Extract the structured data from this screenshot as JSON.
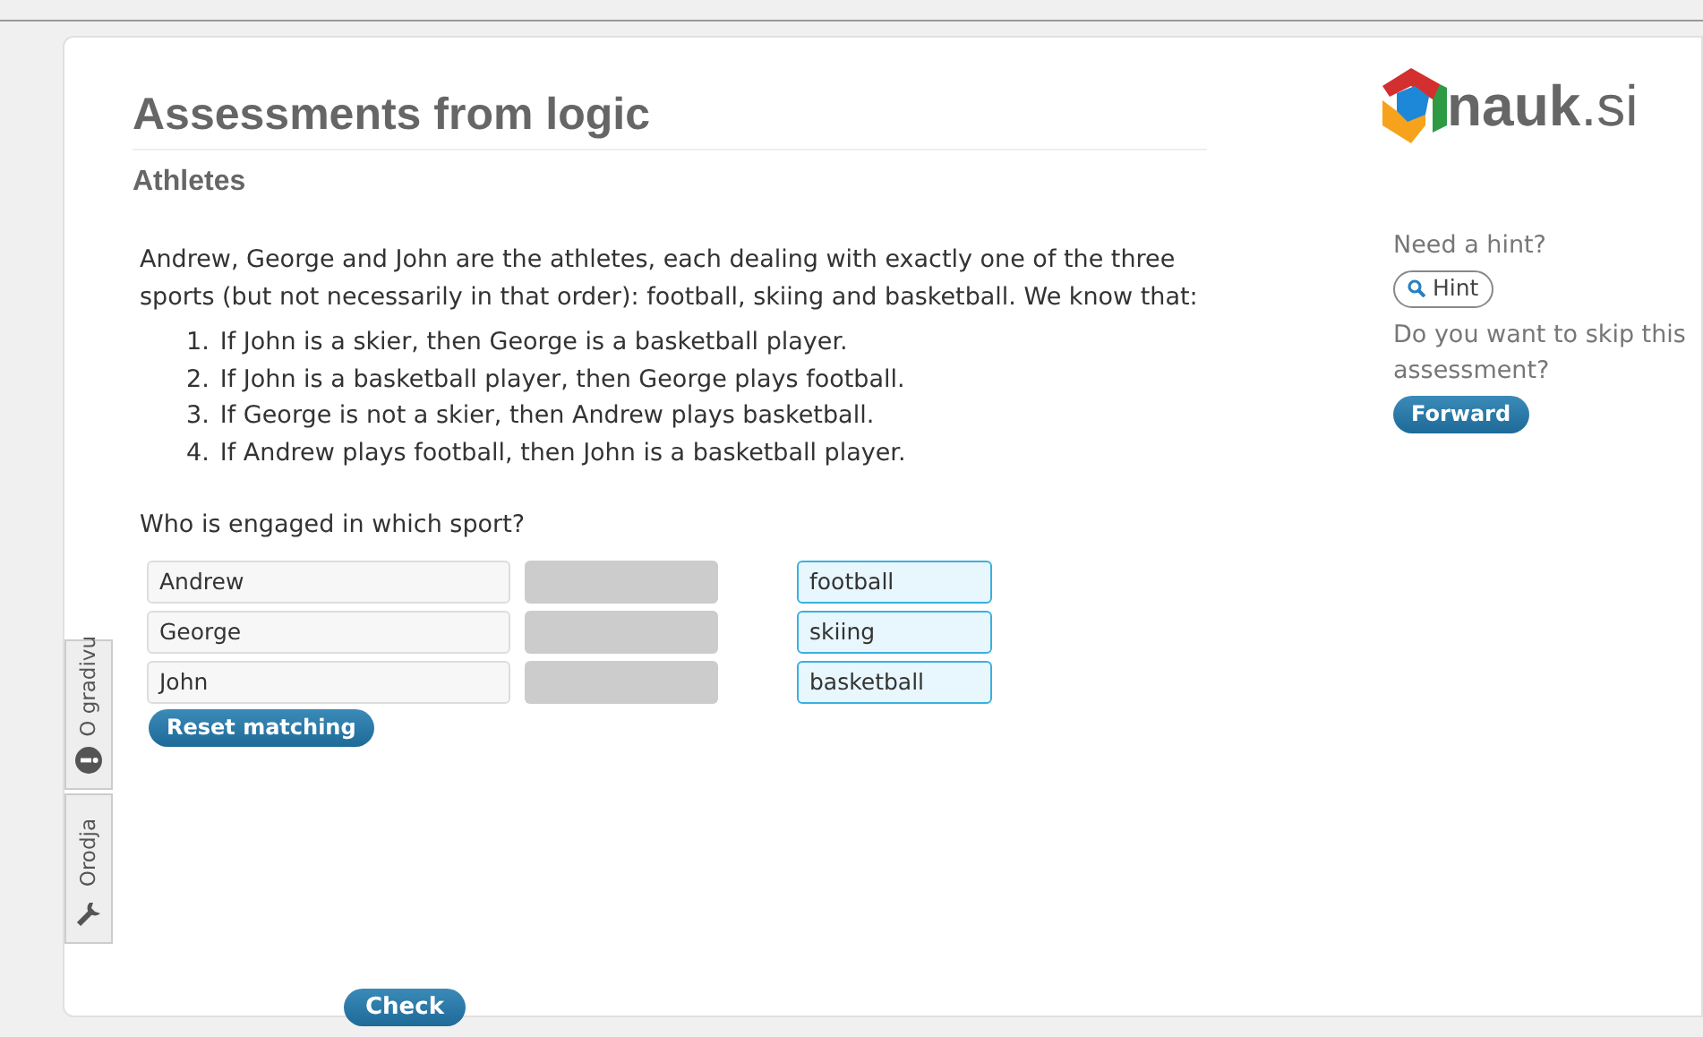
{
  "title": "Assessments from logic",
  "subtitle": "Athletes",
  "logo": {
    "text": "nauk",
    "suffix": ".si"
  },
  "intro": "Andrew, George and John are the athletes, each dealing with exactly one of the three sports (but not necessarily in that order): football, skiing and basketball. We know that:",
  "clues": [
    {
      "number": "1.",
      "text": "If John is a skier, then George is a basketball player."
    },
    {
      "number": "2.",
      "text": "If John is a basketball player, then George plays football."
    },
    {
      "number": "3.",
      "text": "If George is not a skier, then Andrew plays basketball."
    },
    {
      "number": "4.",
      "text": "If Andrew plays football, then John is a basketball player."
    }
  ],
  "question": "Who is engaged in which sport?",
  "people": [
    "Andrew",
    "George",
    "John"
  ],
  "sports": [
    "football",
    "skiing",
    "basketball"
  ],
  "reset_button": "Reset matching",
  "check_button": "Check",
  "side_tabs": [
    {
      "label": "O gradivu",
      "kind": "info"
    },
    {
      "label": "Orodja",
      "kind": "tools"
    }
  ],
  "hint": {
    "prompt": "Need a hint?",
    "button": "Hint"
  },
  "skip": {
    "prompt": "Do you want to skip this assessment?",
    "button": "Forward"
  }
}
